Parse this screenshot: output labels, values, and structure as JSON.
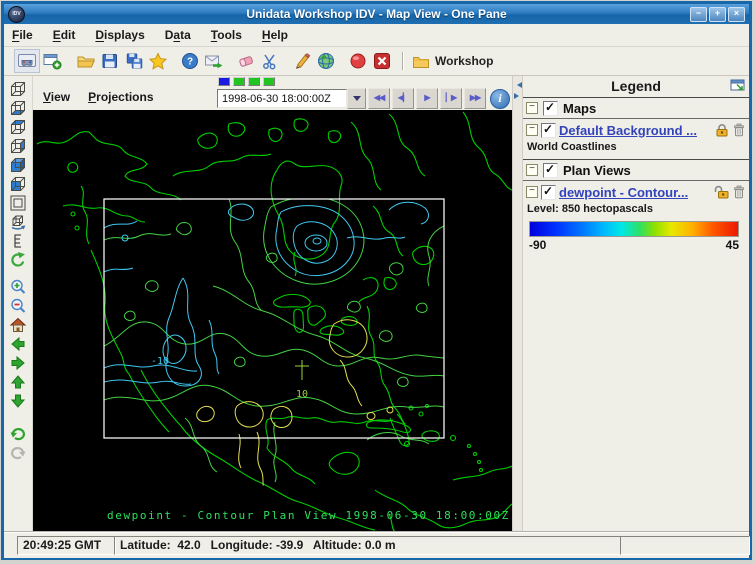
{
  "window": {
    "title": "Unidata Workshop IDV - Map View - One Pane",
    "logo_text": "IDV",
    "control_names": [
      "minimize",
      "maximize",
      "close"
    ]
  },
  "menu_bar": {
    "items": [
      {
        "label": "File",
        "mnemonic": 0
      },
      {
        "label": "Edit",
        "mnemonic": 0
      },
      {
        "label": "Displays",
        "mnemonic": 0
      },
      {
        "label": "Data",
        "mnemonic": 1
      },
      {
        "label": "Tools",
        "mnemonic": 0
      },
      {
        "label": "Help",
        "mnemonic": 0
      }
    ]
  },
  "toolbar": {
    "icon_names": [
      "show-dashboard",
      "new-window",
      "open-bundle",
      "save-bundle",
      "save-as",
      "favorites",
      "help",
      "support-request",
      "erase-displays",
      "cut-displays",
      "edit-formulas",
      "show-globe",
      "cancel-loads",
      "remove-all-displays",
      "workshop-folder"
    ],
    "workshop_label": "Workshop"
  },
  "map_panel": {
    "menus": [
      {
        "label": "View",
        "mnemonic": 0
      },
      {
        "label": "Projections",
        "mnemonic": 0
      }
    ],
    "time_animation": {
      "selected_time": "1998-06-30 18:00:00Z",
      "step_colors": [
        "#1a1ae0",
        "#21c421",
        "#21c421",
        "#21c421"
      ],
      "button_names": [
        "go-to-start",
        "step-back",
        "play",
        "step-forward",
        "go-to-end",
        "animation-properties"
      ]
    },
    "caption": "dewpoint - Contour Plan View 1998-06-30 18:00:00Z",
    "contour_labels": {
      "low": "-10",
      "high": "10"
    }
  },
  "left_toolbar": {
    "icon_names": [
      "perspective-view",
      "cube-bottom-face",
      "cube-top-face",
      "cube-east-face",
      "cube-solid",
      "cube-west-face",
      "set-projection-region",
      "rotate-view",
      "vertical-range",
      "auto-rotate",
      "zoom-in",
      "zoom-out",
      "reset-view",
      "pan-left",
      "pan-right",
      "pan-up",
      "pan-down",
      "undo",
      "redo"
    ]
  },
  "legend": {
    "title": "Legend",
    "maps_section": {
      "label": "Maps",
      "item": {
        "link": "Default Background ...",
        "detail": "World Coastlines"
      }
    },
    "plan_views_section": {
      "label": "Plan Views",
      "item": {
        "link": "dewpoint - Contour...",
        "detail": "Level: 850 hectopascals"
      }
    },
    "colorbar": {
      "min_label": "-90",
      "max_label": "45"
    }
  },
  "status_bar": {
    "clock": "20:49:25 GMT",
    "position": "Latitude:  42.0   Longitude: -39.9   Altitude: 0.0 m"
  }
}
